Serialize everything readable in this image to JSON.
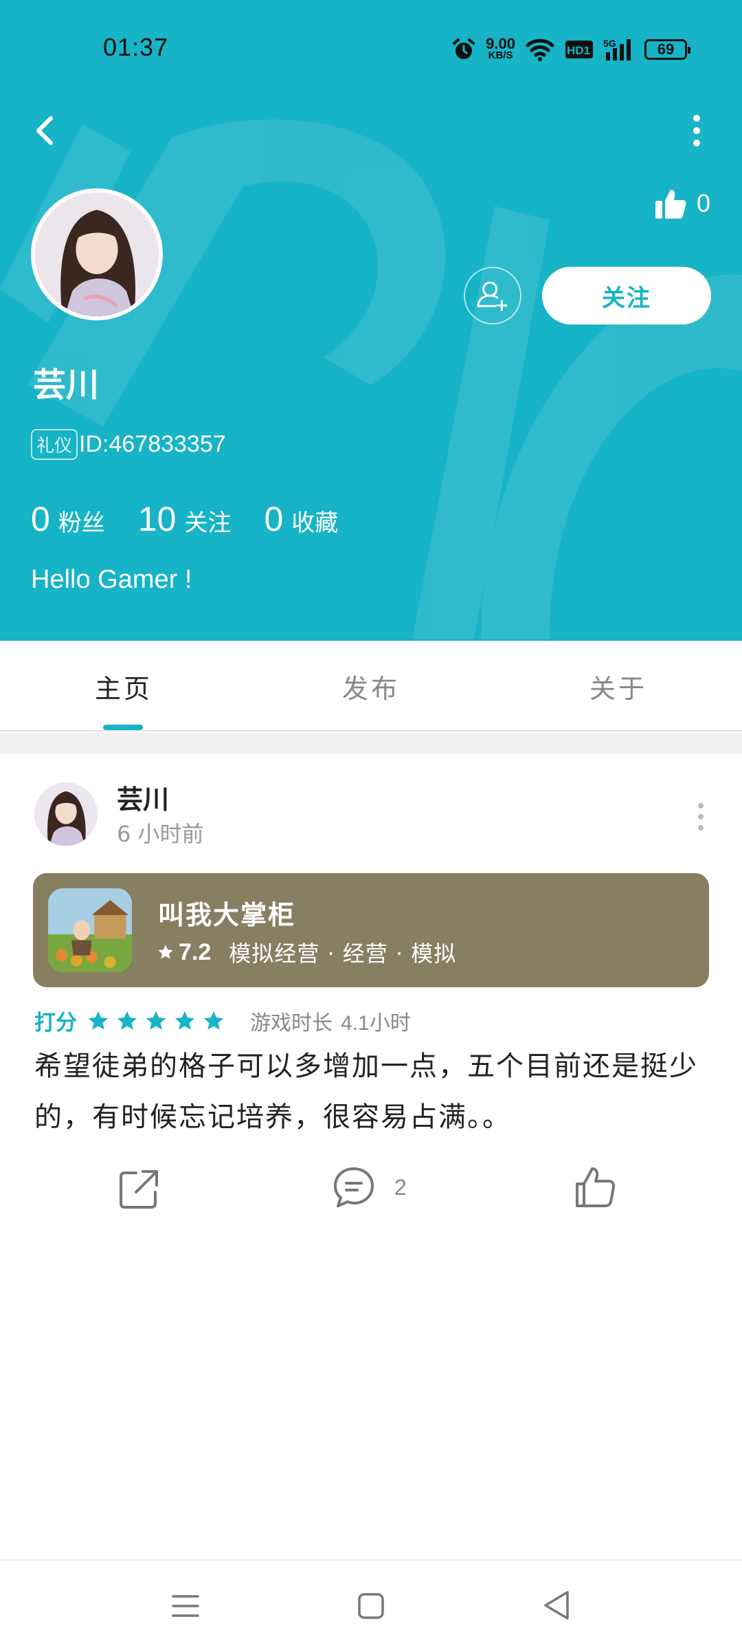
{
  "status_bar": {
    "time": "01:37",
    "net_speed_value": "9.00",
    "net_speed_unit": "KB/S",
    "hd_label": "HD1",
    "signal_label": "5G",
    "battery": "69",
    "icons": [
      "alarm-icon",
      "wifi-icon",
      "hd-icon",
      "signal-icon",
      "battery-icon"
    ]
  },
  "header": {
    "background_color": "#17b3c6",
    "likes": "0",
    "follow_label": "关注"
  },
  "profile": {
    "name": "芸川",
    "badge": "礼仪",
    "id": "ID:467833357",
    "stats": [
      {
        "value": "0",
        "label": "粉丝"
      },
      {
        "value": "10",
        "label": "关注"
      },
      {
        "value": "0",
        "label": "收藏"
      }
    ],
    "bio": "Hello Gamer !"
  },
  "tabs": [
    {
      "label": "主页",
      "active": true
    },
    {
      "label": "发布",
      "active": false
    },
    {
      "label": "关于",
      "active": false
    }
  ],
  "post": {
    "author": "芸川",
    "time": "6 小时前",
    "game": {
      "title": "叫我大掌柜",
      "score": "7.2",
      "tags": "模拟经营 · 经营 · 模拟"
    },
    "rating_label": "打分",
    "rating_stars": 5,
    "playtime_label": "游戏时长",
    "playtime_value": "4.1小时",
    "text": "希望徒弟的格子可以多增加一点，五个目前还是挺少的，有时候忘记培养，很容易占满。。",
    "comment_count": "2"
  },
  "nav_bar": {
    "icons": [
      "menu-icon",
      "home-square-icon",
      "back-triangle-icon"
    ]
  }
}
